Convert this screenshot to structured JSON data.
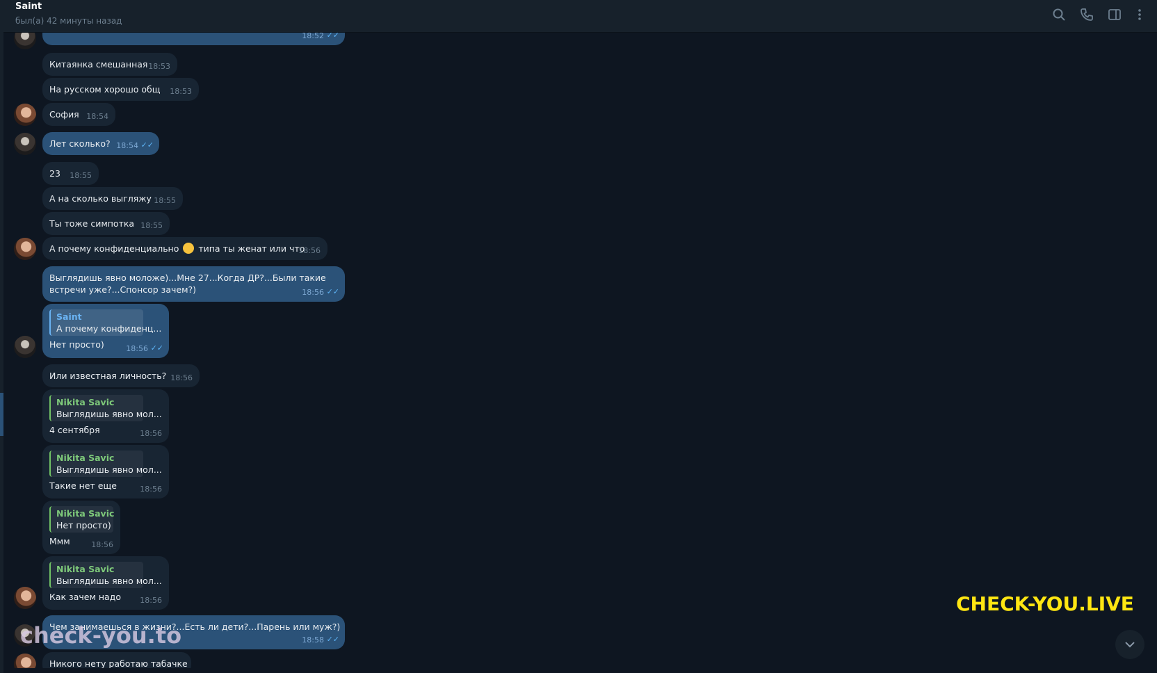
{
  "header": {
    "title": "Saint",
    "status": "был(а) 42 минуты назад"
  },
  "icons": {
    "search": "search-icon",
    "call": "phone-icon",
    "panel": "sidebar-toggle-icon",
    "menu": "more-vertical-icon",
    "scroll": "chevron-down-icon"
  },
  "messages": [
    {
      "dir": "out",
      "text": "",
      "time": "18:52",
      "read": true
    },
    {
      "dir": "in",
      "text": "Китаянка смешанная",
      "time": "18:53"
    },
    {
      "dir": "in",
      "text": "На русском хорошо общ",
      "time": "18:53"
    },
    {
      "dir": "in",
      "text": "София",
      "time": "18:54"
    },
    {
      "dir": "out",
      "text": "Лет сколько?",
      "time": "18:54",
      "read": true
    },
    {
      "dir": "in",
      "text": "23",
      "time": "18:55"
    },
    {
      "dir": "in",
      "text": "А на сколько выгляжу",
      "time": "18:55"
    },
    {
      "dir": "in",
      "text": "Ты тоже симпотка",
      "time": "18:55"
    },
    {
      "dir": "in",
      "text_before": "А почему конфиденциально",
      "text_after": "типа ты женат или что",
      "time": "18:56"
    },
    {
      "dir": "out",
      "line1": "Выглядишь явно моложе)...Мне 27...Когда ДР?...Были такие",
      "line2": "встречи уже?...Спонсор зачем?)",
      "time": "18:56",
      "read": true
    },
    {
      "dir": "out",
      "reply_name": "Saint",
      "reply_text": "А почему конфиденц...",
      "text": "Нет просто)",
      "time": "18:56",
      "read": true
    },
    {
      "dir": "in",
      "text": "Или известная личность?",
      "time": "18:56"
    },
    {
      "dir": "in",
      "reply_name": "Nikita Savic",
      "reply_text": "Выглядишь явно мол...",
      "text": "4 сентября",
      "time": "18:56"
    },
    {
      "dir": "in",
      "reply_name": "Nikita Savic",
      "reply_text": "Выглядишь явно мол...",
      "text": "Такие нет еще",
      "time": "18:56"
    },
    {
      "dir": "in",
      "reply_name": "Nikita Savic",
      "reply_text": "Нет просто)",
      "text": "Ммм",
      "time": "18:56"
    },
    {
      "dir": "in",
      "reply_name": "Nikita Savic",
      "reply_text": "Выглядишь явно мол...",
      "text": "Как зачем надо",
      "time": "18:56"
    },
    {
      "dir": "out",
      "text": "Чем занимаешься в жизни?...Есть ли дети?...Парень или муж?)",
      "time": "18:58",
      "read": true
    },
    {
      "dir": "in",
      "text": "Никого нету работаю табачке",
      "time": ""
    }
  ],
  "watermarks": {
    "top": "CHECK-YOU.LIVE",
    "bottom": "check-you.to"
  },
  "colors": {
    "background": "#0e1621",
    "header": "#17212b",
    "incoming": "#182533",
    "outgoing": "#2b5278",
    "accent": "#6ab3f3",
    "green_reply": "#7ec97a",
    "watermark": "#ffe612"
  }
}
